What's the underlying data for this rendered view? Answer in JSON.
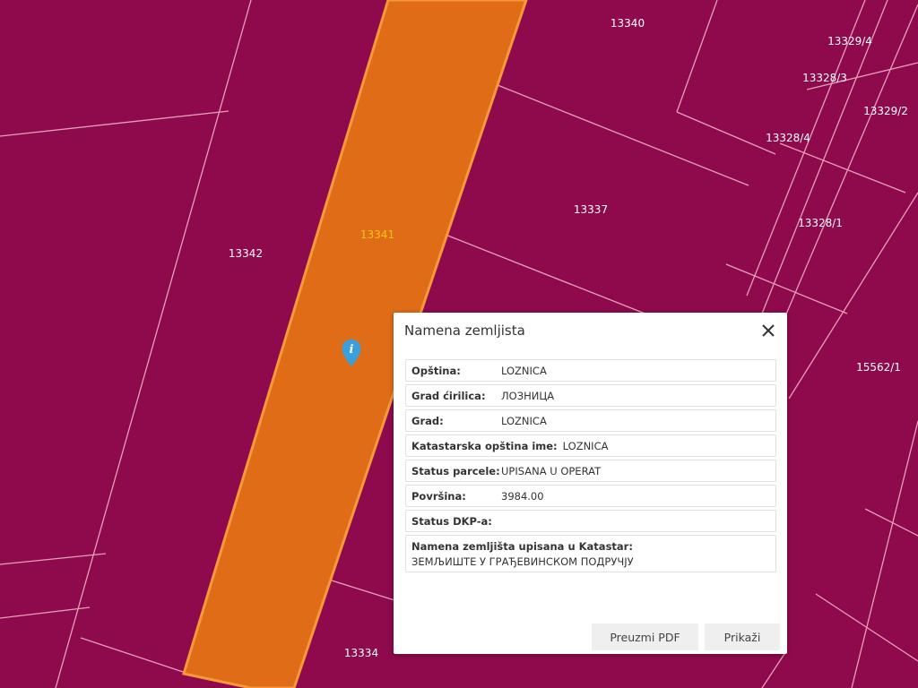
{
  "colors": {
    "parcel_fill": "#8e0a4d",
    "parcel_line": "#e7a0b8",
    "selected_fill": "#e06c18",
    "selected_line": "#f59a3a",
    "pin": "#3aa0dc"
  },
  "parcels": [
    {
      "id": "13340"
    },
    {
      "id": "13329/4"
    },
    {
      "id": "13328/3"
    },
    {
      "id": "13329/2"
    },
    {
      "id": "13328/4"
    },
    {
      "id": "13337"
    },
    {
      "id": "13328/1"
    },
    {
      "id": "13342"
    },
    {
      "id": "13341",
      "selected": true
    },
    {
      "id": "15562/1"
    },
    {
      "id": "13334"
    }
  ],
  "popup": {
    "title": "Namena zemljista",
    "close_icon": "close-icon",
    "rows": [
      {
        "key": "Opština:",
        "value": "LOZNICA"
      },
      {
        "key": "Grad ćirilica:",
        "value": "ЛОЗНИЦА"
      },
      {
        "key": "Grad:",
        "value": "LOZNICA"
      },
      {
        "key": "Katastarska opština ime:",
        "value": "LOZNICA"
      },
      {
        "key": "Status parcele:",
        "value": "UPISANA U OPERAT"
      },
      {
        "key": "Površina:",
        "value": "3984.00"
      },
      {
        "key": "Status DKP-a:",
        "value": ""
      }
    ],
    "purpose_key": "Namena zemljišta upisana u Katastar:",
    "purpose_value": "ЗЕМЉИШТЕ У ГРАЂЕВИНСКОМ ПОДРУЧЈУ",
    "buttons": {
      "pdf": "Preuzmi PDF",
      "show": "Prikaži"
    }
  }
}
